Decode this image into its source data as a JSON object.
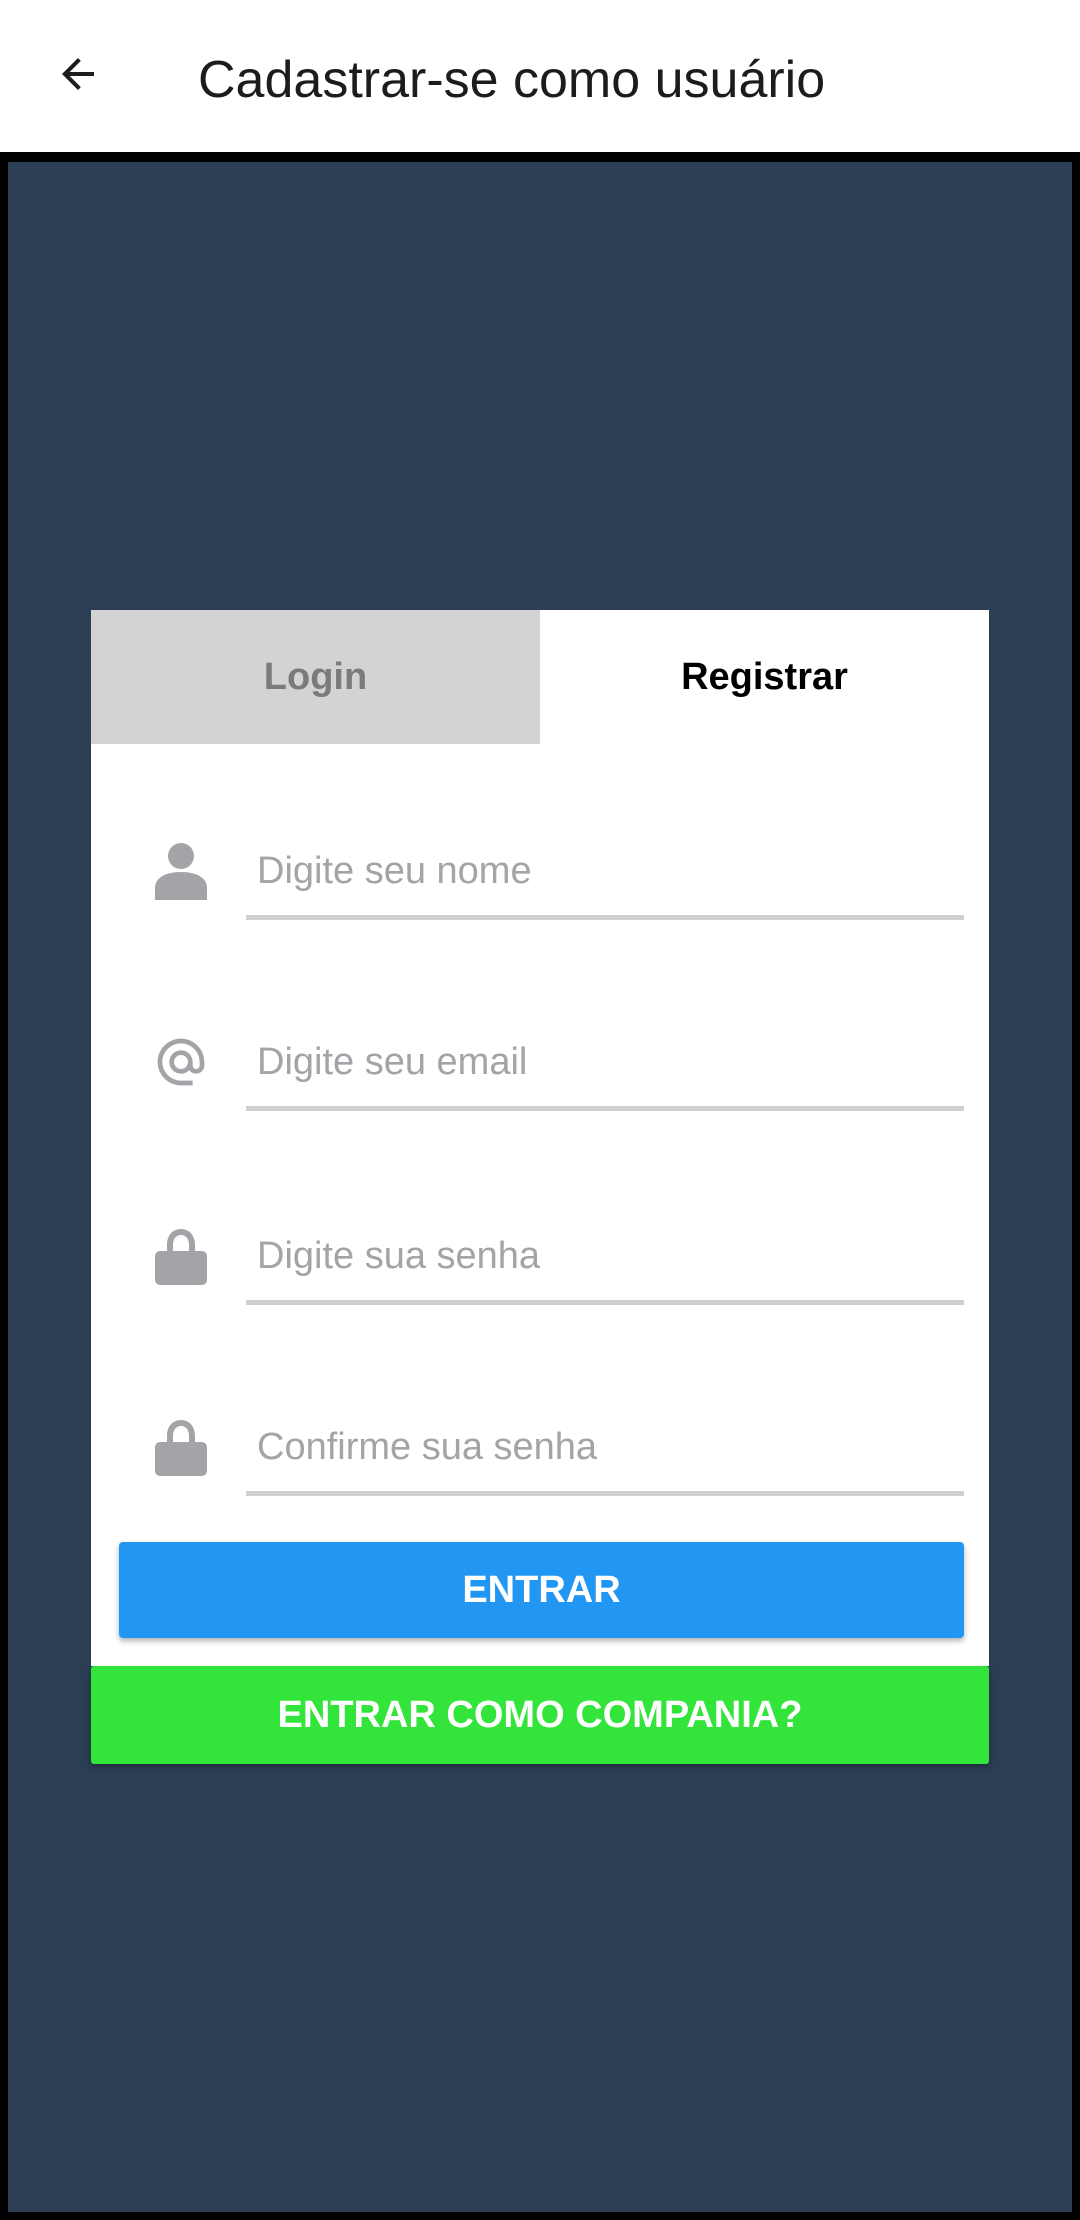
{
  "app_bar": {
    "back_icon": "arrow-back-icon",
    "title": "Cadastrar-se como usuário"
  },
  "tabs": [
    {
      "label": "Login",
      "selected": false
    },
    {
      "label": "Registrar",
      "selected": true
    }
  ],
  "form": {
    "fields": [
      {
        "icon": "person-icon",
        "placeholder": "Digite seu nome",
        "value": ""
      },
      {
        "icon": "at-sign-icon",
        "placeholder": "Digite seu email",
        "value": ""
      },
      {
        "icon": "lock-icon",
        "placeholder": "Digite sua senha",
        "value": ""
      },
      {
        "icon": "lock-icon",
        "placeholder": "Confirme sua senha",
        "value": ""
      }
    ],
    "submit_label": "ENTRAR"
  },
  "company_button_label": "ENTRAR COMO COMPANIA?",
  "colors": {
    "background": "#2c3e53",
    "primary_button": "#2196f3",
    "company_button": "#33e43a",
    "inactive_tab": "#d3d3d3",
    "icon_gray": "#a3a3a8"
  }
}
